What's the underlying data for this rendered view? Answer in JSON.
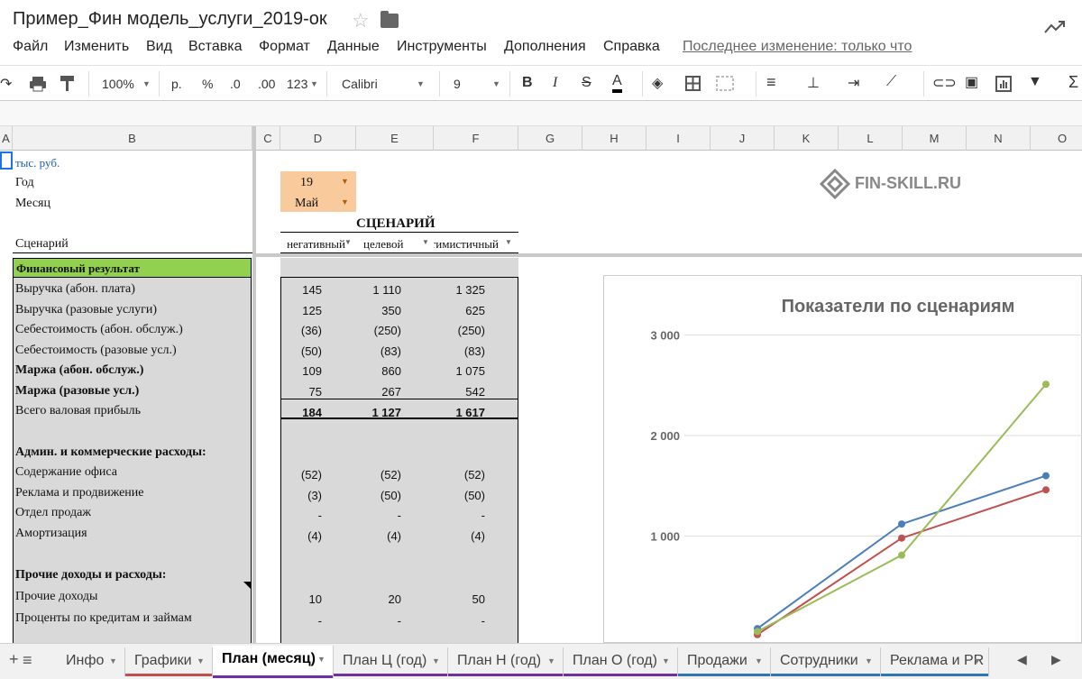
{
  "doc": {
    "title": "Пример_Фин модель_услуги_2019-ок",
    "last_edit": "Последнее изменение: только что"
  },
  "menu": [
    "Файл",
    "Изменить",
    "Вид",
    "Вставка",
    "Формат",
    "Данные",
    "Инструменты",
    "Дополнения",
    "Справка"
  ],
  "toolbar": {
    "zoom": "100%",
    "currency": "р.",
    "percent": "%",
    "dec_less": ".0",
    "dec_more": ".00",
    "format": "123",
    "font": "Calibri",
    "size": "9"
  },
  "columns": [
    "A",
    "B",
    "C",
    "D",
    "E",
    "F",
    "G",
    "H",
    "I",
    "J",
    "K",
    "L",
    "M",
    "N",
    "O"
  ],
  "sheet": {
    "units": "тыс. руб.",
    "year_label": "Год",
    "month_label": "Месяц",
    "year_value": "19",
    "month_value": "Май",
    "scenario_title": "СЦЕНАРИЙ",
    "scenario_label": "Сценарий",
    "scenarios": [
      "негативный",
      "целевой",
      "оптимистичный"
    ],
    "fin_result": "Финансовый результат",
    "rows": [
      {
        "label": "Выручка (абон. плата)",
        "v": [
          "145",
          "1 110",
          "1 325"
        ]
      },
      {
        "label": "Выручка (разовые услуги)",
        "v": [
          "125",
          "350",
          "625"
        ]
      },
      {
        "label": "Себестоимость (абон. обслуж.)",
        "v": [
          "(36)",
          "(250)",
          "(250)"
        ]
      },
      {
        "label": "Себестоимость (разовые усл.)",
        "v": [
          "(50)",
          "(83)",
          "(83)"
        ]
      },
      {
        "label": "Маржа (абон. обслуж.)",
        "v": [
          "109",
          "860",
          "1 075"
        ]
      },
      {
        "label": "Маржа (разовые усл.)",
        "v": [
          "75",
          "267",
          "542"
        ]
      },
      {
        "label": "Всего валовая прибыль",
        "v": [
          "184",
          "1 127",
          "1 617"
        ]
      },
      {
        "label": "Админ. и коммерческие расходы:",
        "v": [
          "",
          "",
          ""
        ]
      },
      {
        "label": "Содержание офиса",
        "v": [
          "(52)",
          "(52)",
          "(52)"
        ]
      },
      {
        "label": "Реклама и продвижение",
        "v": [
          "(3)",
          "(50)",
          "(50)"
        ]
      },
      {
        "label": "Отдел продаж",
        "v": [
          "-",
          "-",
          "-"
        ]
      },
      {
        "label": "Амортизация",
        "v": [
          "(4)",
          "(4)",
          "(4)"
        ]
      },
      {
        "label": "Прочие доходы и расходы:",
        "v": [
          "",
          "",
          ""
        ]
      },
      {
        "label": "Прочие доходы",
        "v": [
          "10",
          "20",
          "50"
        ]
      },
      {
        "label": "Проценты по кредитам и займам",
        "v": [
          "-",
          "-",
          "-"
        ]
      }
    ]
  },
  "logo": "FIN-SKILL.RU",
  "chart_data": {
    "type": "line",
    "title": "Показатели по сценариям",
    "yticks": [
      "3 000",
      "2 000",
      "1 000"
    ],
    "ylim": [
      0,
      3300
    ],
    "series": [
      {
        "color": "#4a7ebb",
        "values": [
          80,
          1120,
          1600
        ]
      },
      {
        "color": "#c0504d",
        "values": [
          20,
          980,
          1460
        ]
      },
      {
        "color": "#9bbb59",
        "values": [
          50,
          810,
          2510
        ]
      }
    ]
  },
  "tabs": [
    {
      "label": "Инфо",
      "color": ""
    },
    {
      "label": "Графики",
      "color": "#c0504d"
    },
    {
      "label": "План (месяц)",
      "color": "#7030a0"
    },
    {
      "label": "План Ц (год)",
      "color": "#7030a0"
    },
    {
      "label": "План Н (год)",
      "color": "#7030a0"
    },
    {
      "label": "План О (год)",
      "color": "#7030a0"
    },
    {
      "label": "Продажи",
      "color": "#2e75b6"
    },
    {
      "label": "Сотрудники",
      "color": "#2e75b6"
    },
    {
      "label": "Реклама и PR",
      "color": "#2e75b6"
    }
  ]
}
